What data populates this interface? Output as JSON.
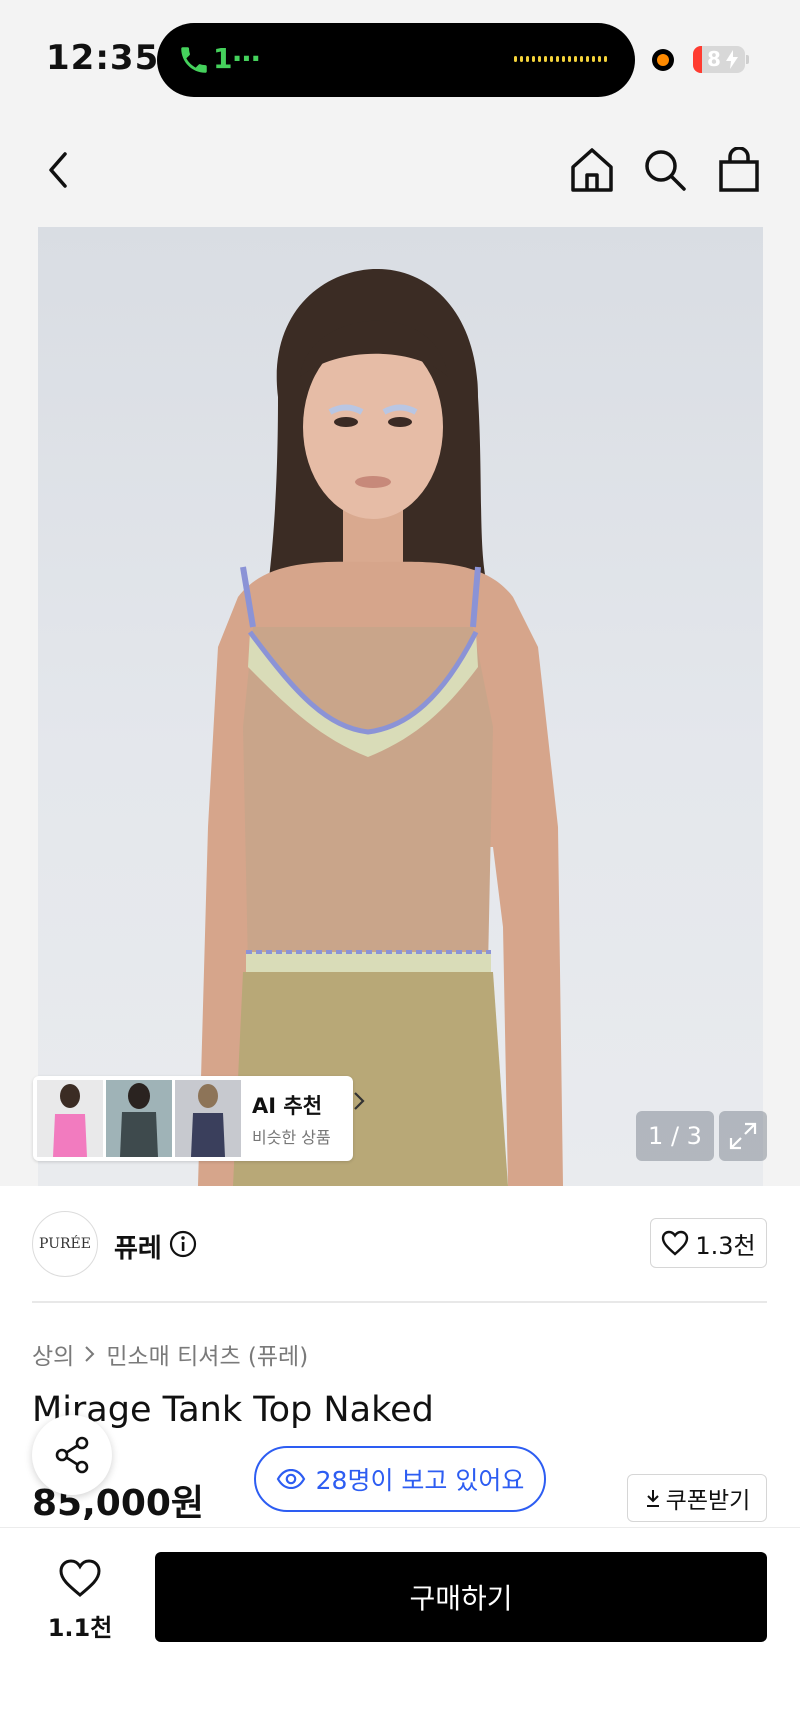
{
  "status_bar": {
    "time": "12:35",
    "call_indicator": "1⋯",
    "battery": "8"
  },
  "nav": {
    "icons": [
      "back-arrow-icon",
      "home-icon",
      "search-icon",
      "shopping-bag-icon"
    ]
  },
  "gallery": {
    "page_indicator": "1 / 3",
    "ai_recommend": {
      "title": "AI 추천",
      "subtitle": "비슷한 상품"
    }
  },
  "brand": {
    "logo_text": "PURÉE",
    "name": "퓨레",
    "like_count": "1.3천"
  },
  "breadcrumb": {
    "category": "상의",
    "subcategory": "민소매 티셔츠 (퓨레)"
  },
  "product": {
    "title": "Mirage Tank Top Naked",
    "price": "85,000원"
  },
  "viewers_label": "28명이 보고 있어요",
  "coupon_label": "쿠폰받기",
  "bottom_bar": {
    "wish_count": "1.1천",
    "buy_label": "구매하기"
  },
  "colors": {
    "accent_blue": "#2d5df2",
    "buy_button": "#000000",
    "call_green": "#45d15c"
  }
}
